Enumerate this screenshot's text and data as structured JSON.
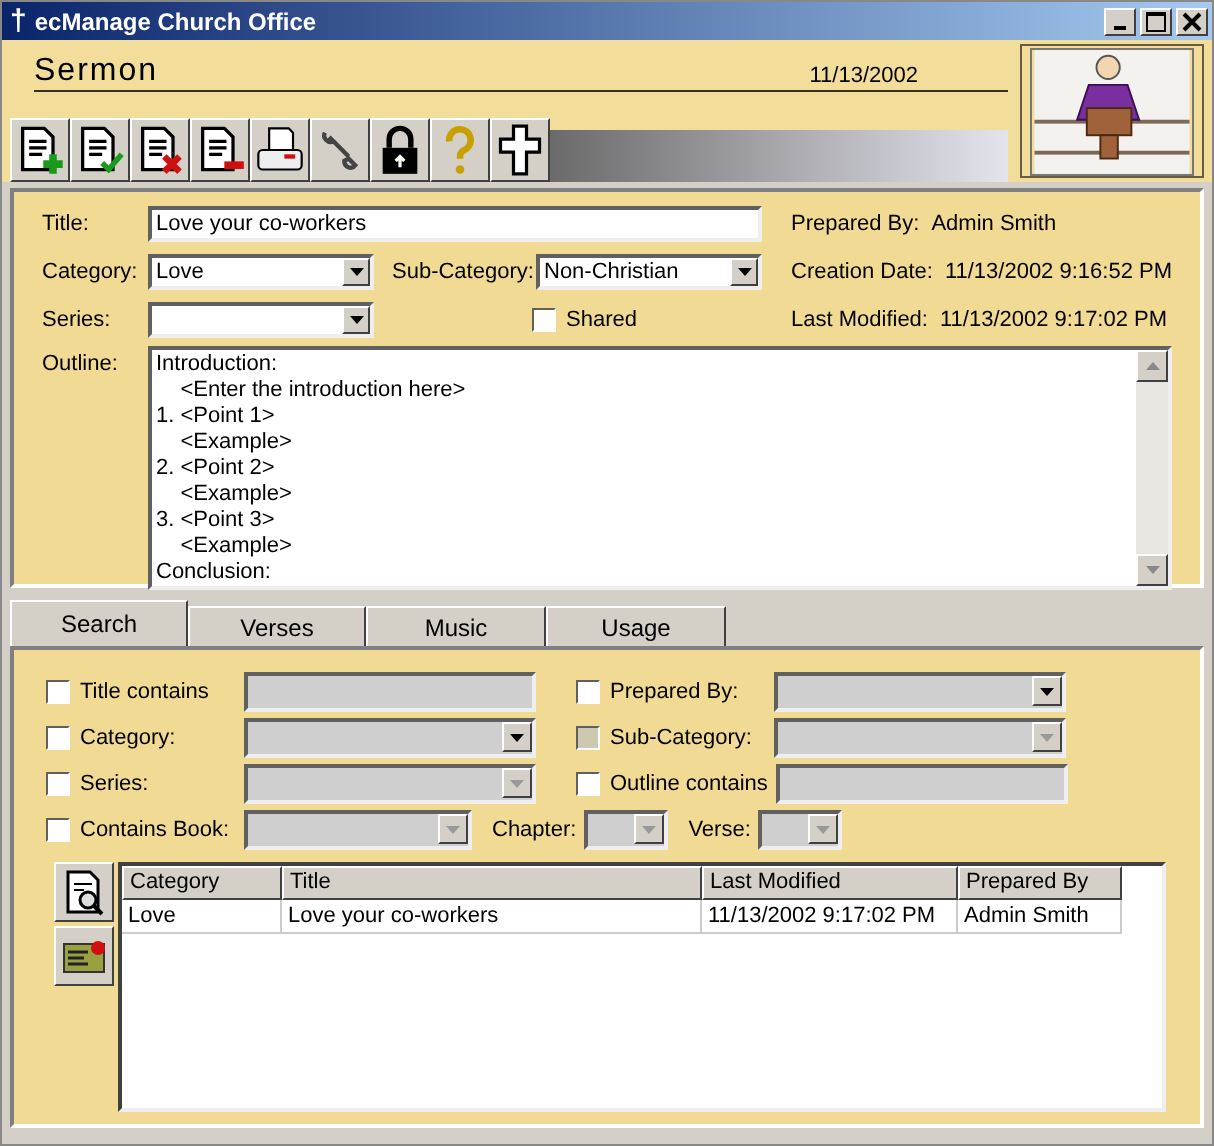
{
  "window": {
    "title": "ecManage Church Office",
    "title_icon": "†"
  },
  "header": {
    "title": "Sermon",
    "date": "11/13/2002"
  },
  "toolbar": [
    {
      "kind": "add"
    },
    {
      "kind": "approve"
    },
    {
      "kind": "delete"
    },
    {
      "kind": "remove"
    },
    {
      "kind": "print"
    },
    {
      "kind": "tools"
    },
    {
      "kind": "lock"
    },
    {
      "kind": "help"
    },
    {
      "kind": "cross"
    }
  ],
  "form": {
    "title": {
      "label": "Title:",
      "value": "Love your co-workers"
    },
    "category": {
      "label": "Category:",
      "value": "Love"
    },
    "sub_category": {
      "label": "Sub-Category:",
      "value": "Non-Christian"
    },
    "series": {
      "label": "Series:"
    },
    "shared": {
      "label": "Shared",
      "checked": false
    },
    "info": [
      {
        "label": "Prepared By:",
        "value": "Admin Smith"
      },
      {
        "label": "Creation Date:",
        "value": "11/13/2002 9:16:52 PM"
      },
      {
        "label": "Last Modified:",
        "value": "11/13/2002 9:17:02 PM"
      }
    ],
    "outline": {
      "label": "Outline:",
      "value": "Introduction:\n    <Enter the introduction here>\n1. <Point 1>\n    <Example>\n2. <Point 2>\n    <Example>\n3. <Point 3>\n    <Example>\nConclusion:"
    }
  },
  "tabs": [
    {
      "label": "Search",
      "selected": true
    },
    {
      "label": "Verses",
      "selected": false
    },
    {
      "label": "Music",
      "selected": false
    },
    {
      "label": "Usage",
      "selected": false
    }
  ],
  "search": {
    "rows": [
      [
        {
          "kind": "text",
          "label": "Title contains",
          "checked": false,
          "disabled": false
        },
        {
          "kind": "dropdown",
          "label": "Prepared By:",
          "checked": false,
          "disabled": false,
          "active": true
        }
      ],
      [
        {
          "kind": "dropdown",
          "label": "Category:",
          "checked": false,
          "disabled": false,
          "active": true
        },
        {
          "kind": "dropdown",
          "label": "Sub-Category:",
          "checked": false,
          "disabled": true,
          "active": false
        }
      ],
      [
        {
          "kind": "dropdown",
          "label": "Series:",
          "checked": false,
          "disabled": false,
          "active": false
        },
        {
          "kind": "text",
          "label": "Outline contains",
          "checked": false,
          "disabled": false
        }
      ],
      [
        {
          "kind": "dropdown",
          "label": "Contains Book:",
          "checked": false,
          "disabled": false,
          "active": false
        },
        {
          "kind": "plain-dropdown",
          "label": "Chapter:",
          "active": false
        },
        {
          "kind": "plain-dropdown",
          "label": "Verse:",
          "active": false
        }
      ]
    ]
  },
  "results": {
    "side_buttons": [
      {
        "kind": "view"
      },
      {
        "kind": "edit"
      }
    ],
    "columns": [
      "Category",
      "Title",
      "Last Modified",
      "Prepared By"
    ],
    "rows": [
      [
        "Love",
        "Love your co-workers",
        "11/13/2002 9:17:02 PM",
        "Admin Smith"
      ]
    ]
  }
}
